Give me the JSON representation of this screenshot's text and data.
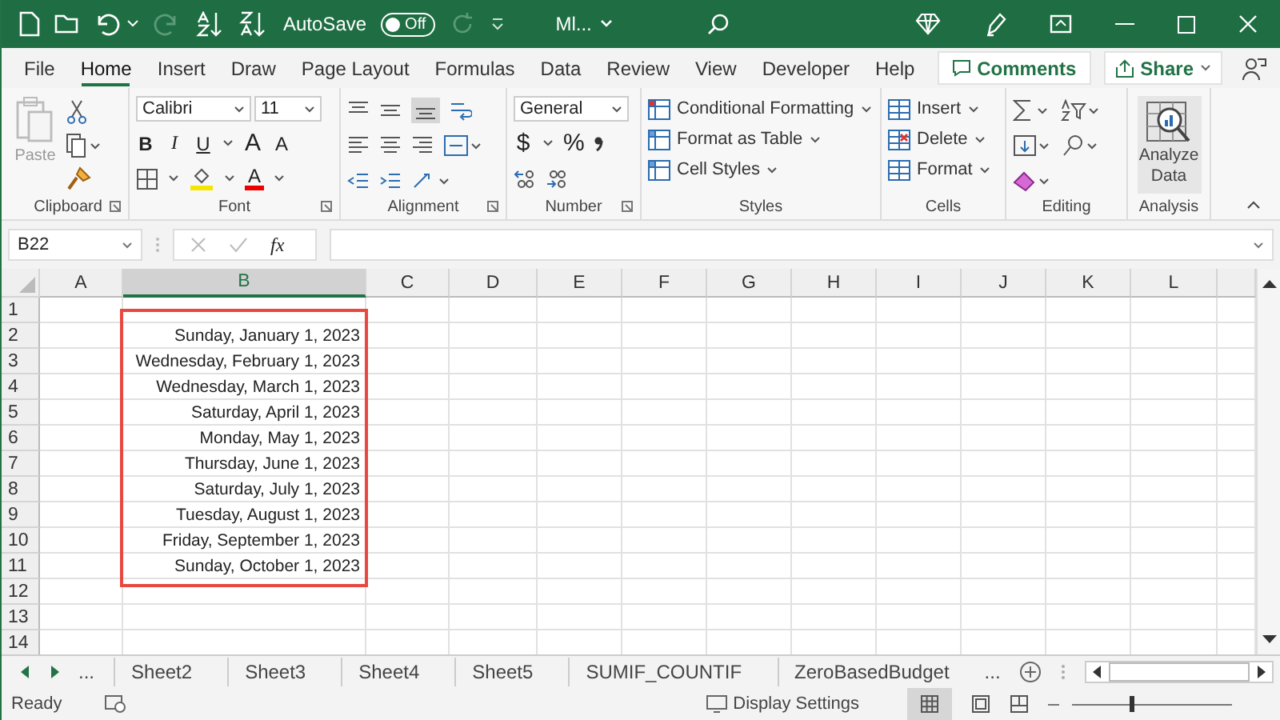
{
  "title_bar": {
    "autosave_label": "AutoSave",
    "autosave_toggle": {
      "label": "Off",
      "on": false
    },
    "file_name": "Ml..."
  },
  "menu_tabs": [
    {
      "label": "File",
      "selected": false
    },
    {
      "label": "Home",
      "selected": true
    },
    {
      "label": "Insert",
      "selected": false
    },
    {
      "label": "Draw",
      "selected": false
    },
    {
      "label": "Page Layout",
      "selected": false
    },
    {
      "label": "Formulas",
      "selected": false
    },
    {
      "label": "Data",
      "selected": false
    },
    {
      "label": "Review",
      "selected": false
    },
    {
      "label": "View",
      "selected": false
    },
    {
      "label": "Developer",
      "selected": false
    },
    {
      "label": "Help",
      "selected": false
    }
  ],
  "comments_button": "Comments",
  "share_button": "Share",
  "ribbon": {
    "clipboard": {
      "paste": "Paste",
      "label": "Clipboard"
    },
    "font": {
      "font_name": "Calibri",
      "font_size": "11",
      "bold": "B",
      "italic": "I",
      "underline": "U",
      "grow": "A",
      "shrink": "A",
      "font_color": "A",
      "label": "Font"
    },
    "alignment": {
      "label": "Alignment"
    },
    "number": {
      "format": "General",
      "currency": "$",
      "percent": "%",
      "label": "Number"
    },
    "styles": {
      "items": [
        "Conditional Formatting",
        "Format as Table",
        "Cell Styles"
      ],
      "label": "Styles"
    },
    "cells": {
      "items": [
        "Insert",
        "Delete",
        "Format"
      ],
      "label": "Cells"
    },
    "editing": {
      "label": "Editing"
    },
    "analysis": {
      "button": "Analyze Data",
      "label": "Analysis"
    }
  },
  "formula_bar": {
    "name_box": "B22",
    "fx": "fx"
  },
  "grid": {
    "columns": [
      {
        "label": "A",
        "selected": false
      },
      {
        "label": "B",
        "selected": true
      },
      {
        "label": "C",
        "selected": false
      },
      {
        "label": "D",
        "selected": false
      },
      {
        "label": "E",
        "selected": false
      },
      {
        "label": "F",
        "selected": false
      },
      {
        "label": "G",
        "selected": false
      },
      {
        "label": "H",
        "selected": false
      },
      {
        "label": "I",
        "selected": false
      },
      {
        "label": "J",
        "selected": false
      },
      {
        "label": "K",
        "selected": false
      },
      {
        "label": "L",
        "selected": false
      }
    ],
    "rows": [
      {
        "number": "1",
        "cells": [
          "",
          ""
        ]
      },
      {
        "number": "2",
        "cells": [
          "",
          "Sunday, January 1, 2023"
        ]
      },
      {
        "number": "3",
        "cells": [
          "",
          "Wednesday, February 1, 2023"
        ]
      },
      {
        "number": "4",
        "cells": [
          "",
          "Wednesday, March 1, 2023"
        ]
      },
      {
        "number": "5",
        "cells": [
          "",
          "Saturday, April 1, 2023"
        ]
      },
      {
        "number": "6",
        "cells": [
          "",
          "Monday, May 1, 2023"
        ]
      },
      {
        "number": "7",
        "cells": [
          "",
          "Thursday, June 1, 2023"
        ]
      },
      {
        "number": "8",
        "cells": [
          "",
          "Saturday, July 1, 2023"
        ]
      },
      {
        "number": "9",
        "cells": [
          "",
          "Tuesday, August 1, 2023"
        ]
      },
      {
        "number": "10",
        "cells": [
          "",
          "Friday, September 1, 2023"
        ]
      },
      {
        "number": "11",
        "cells": [
          "",
          "Sunday, October 1, 2023"
        ]
      },
      {
        "number": "12",
        "cells": [
          "",
          ""
        ]
      },
      {
        "number": "13",
        "cells": [
          "",
          ""
        ]
      },
      {
        "number": "14",
        "cells": [
          "",
          ""
        ]
      }
    ]
  },
  "sheet_tabs": {
    "more_left": "...",
    "tabs": [
      {
        "label": "Sheet2",
        "selected": false
      },
      {
        "label": "Sheet3",
        "selected": false
      },
      {
        "label": "Sheet4",
        "selected": false
      },
      {
        "label": "Sheet5",
        "selected": false
      },
      {
        "label": "SUMIF_COUNTIF",
        "selected": false
      },
      {
        "label": "ZeroBasedBudget",
        "selected": false
      }
    ],
    "more_right": "..."
  },
  "status_bar": {
    "status": "Ready",
    "display_settings": "Display Settings",
    "zoom_slider": {
      "level": 0.37
    }
  }
}
